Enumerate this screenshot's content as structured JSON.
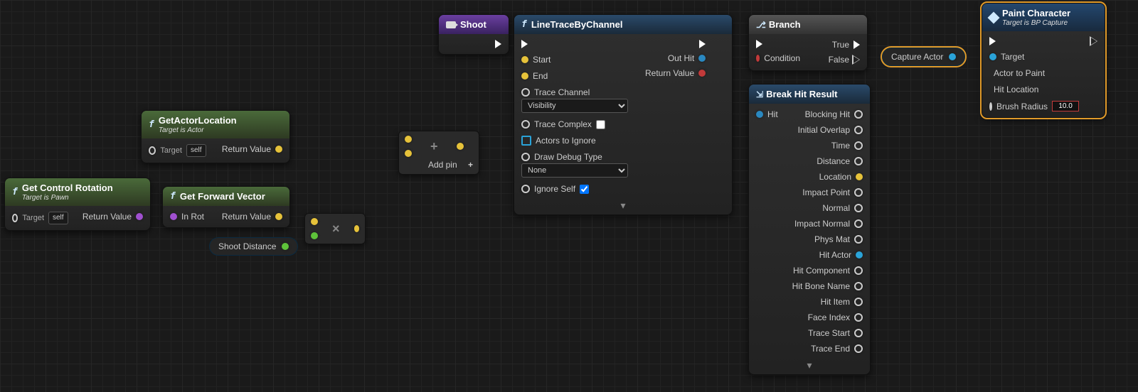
{
  "nodes": {
    "getActorLocation": {
      "title": "GetActorLocation",
      "subtitle": "Target is Actor",
      "targetLabel": "Target",
      "targetDefault": "self",
      "returnLabel": "Return Value"
    },
    "getControlRotation": {
      "title": "Get Control Rotation",
      "subtitle": "Target is Pawn",
      "targetLabel": "Target",
      "targetDefault": "self",
      "returnLabel": "Return Value"
    },
    "getForwardVector": {
      "title": "Get Forward Vector",
      "inRotLabel": "In Rot",
      "returnLabel": "Return Value"
    },
    "shootDistance": {
      "label": "Shoot Distance"
    },
    "multiply": {
      "symbol": "×"
    },
    "add": {
      "symbol": "+",
      "addPinLabel": "Add pin"
    },
    "shoot": {
      "title": "Shoot"
    },
    "lineTrace": {
      "title": "LineTraceByChannel",
      "start": "Start",
      "end": "End",
      "traceChannelLabel": "Trace Channel",
      "traceChannelValue": "Visibility",
      "traceComplex": "Trace Complex",
      "actorsIgnore": "Actors to Ignore",
      "drawDebugLabel": "Draw Debug Type",
      "drawDebugValue": "None",
      "ignoreSelf": "Ignore Self",
      "outHit": "Out Hit",
      "returnValue": "Return Value"
    },
    "branch": {
      "title": "Branch",
      "condition": "Condition",
      "true": "True",
      "false": "False"
    },
    "breakHit": {
      "title": "Break Hit Result",
      "hit": "Hit",
      "outs": [
        "Blocking Hit",
        "Initial Overlap",
        "Time",
        "Distance",
        "Location",
        "Impact Point",
        "Normal",
        "Impact Normal",
        "Phys Mat",
        "Hit Actor",
        "Hit Component",
        "Hit Bone Name",
        "Hit Item",
        "Face Index",
        "Trace Start",
        "Trace End"
      ]
    },
    "captureActor": {
      "label": "Capture Actor"
    },
    "paintCharacter": {
      "title": "Paint Character",
      "subtitle": "Target is BP Capture",
      "target": "Target",
      "actorToPaint": "Actor to Paint",
      "hitLocation": "Hit Location",
      "brushRadius": "Brush Radius",
      "brushRadiusValue": "10.0"
    }
  }
}
